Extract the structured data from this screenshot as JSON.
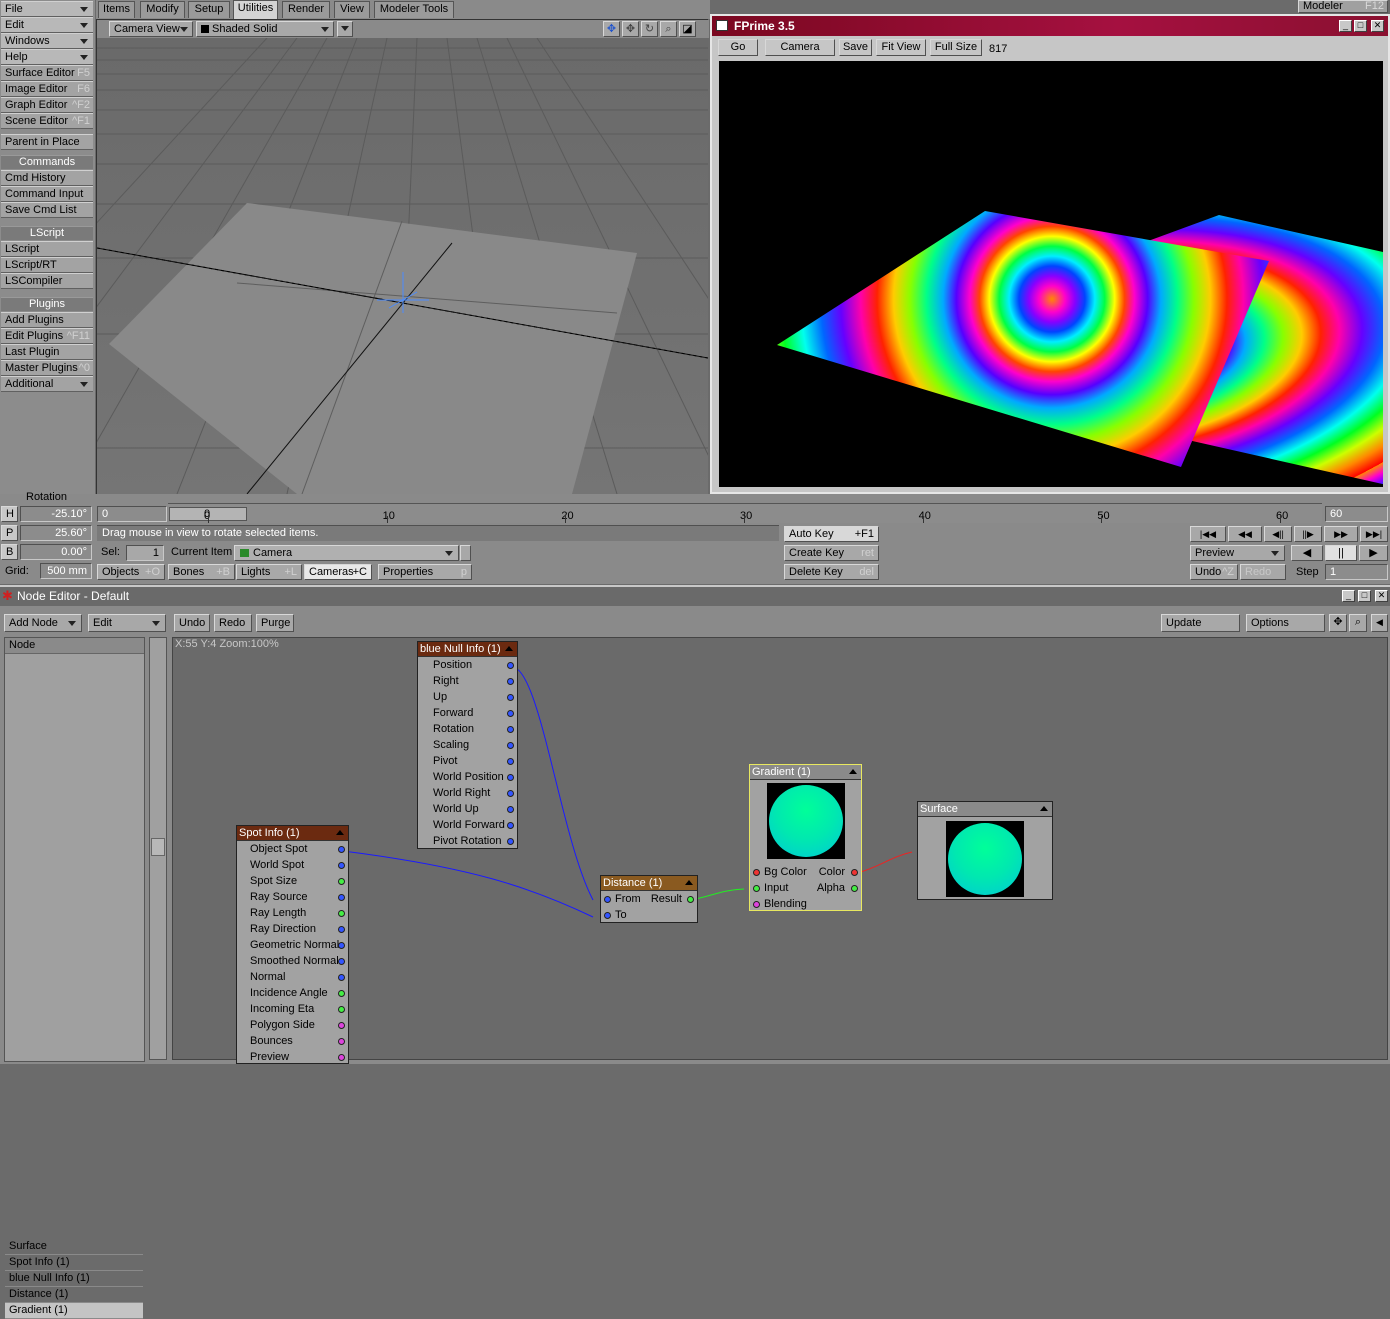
{
  "left_menu": {
    "top": [
      {
        "label": "File",
        "name": "menu-file"
      },
      {
        "label": "Edit",
        "name": "menu-edit"
      },
      {
        "label": "Windows",
        "name": "menu-windows"
      },
      {
        "label": "Help",
        "name": "menu-help"
      }
    ],
    "editors": [
      {
        "label": "Surface Editor",
        "shortcut": "F5"
      },
      {
        "label": "Image Editor",
        "shortcut": "F6"
      },
      {
        "label": "Graph Editor",
        "shortcut": "^F2"
      },
      {
        "label": "Scene Editor",
        "shortcut": "^F1"
      }
    ],
    "parent_in_place": "Parent in Place",
    "commands_header": "Commands",
    "commands": [
      "Cmd History",
      "Command Input",
      "Save Cmd List"
    ],
    "lscript_header": "LScript",
    "lscript": [
      "LScript",
      "LScript/RT",
      "LSCompiler"
    ],
    "plugins_header": "Plugins",
    "plugins": [
      {
        "label": "Add Plugins",
        "shortcut": ""
      },
      {
        "label": "Edit Plugins",
        "shortcut": "^F11"
      },
      {
        "label": "Last Plugin",
        "shortcut": ""
      },
      {
        "label": "Master Plugins",
        "shortcut": "^0"
      }
    ],
    "additional": "Additional"
  },
  "tabs": [
    "Items",
    "Modify",
    "Setup",
    "Utilities",
    "Render",
    "View",
    "Modeler Tools"
  ],
  "active_tab": "Utilities",
  "viewport": {
    "view": "Camera View",
    "shading": "Shaded Solid"
  },
  "fprime": {
    "title": "FPrime 3.5",
    "buttons": [
      "Go",
      "Camera",
      "Save",
      "Fit View",
      "Full Size"
    ],
    "pass_count": "817"
  },
  "modeler_button": {
    "label": "Modeler",
    "shortcut": "F12"
  },
  "rotation": {
    "label": "Rotation",
    "h": {
      "key": "H",
      "value": "-25.10°"
    },
    "p": {
      "key": "P",
      "value": "25.60°"
    },
    "b": {
      "key": "B",
      "value": "0.00°"
    }
  },
  "grid": {
    "label": "Grid:",
    "value": "500 mm"
  },
  "timeline": {
    "start": "0",
    "current": "0",
    "ticks": [
      "0",
      "10",
      "20",
      "30",
      "40",
      "50",
      "60"
    ],
    "end": "60"
  },
  "status_message": "Drag mouse in view to rotate selected items.",
  "sel": {
    "label": "Sel:",
    "value": "1"
  },
  "current_item": {
    "label": "Current Item",
    "value": "Camera"
  },
  "item_types": [
    {
      "label": "Objects",
      "shortcut": "+O"
    },
    {
      "label": "Bones",
      "shortcut": "+B"
    },
    {
      "label": "Lights",
      "shortcut": "+L"
    },
    {
      "label": "Cameras",
      "shortcut": "+C"
    }
  ],
  "properties": {
    "label": "Properties",
    "shortcut": "p"
  },
  "keys": {
    "auto_key": {
      "label": "Auto Key",
      "shortcut": "+F1"
    },
    "create_key": {
      "label": "Create Key",
      "shortcut": "ret"
    },
    "delete_key": {
      "label": "Delete Key",
      "shortcut": "del"
    }
  },
  "playback": {
    "preview": "Preview",
    "undo": "Undo",
    "undo_shortcut": "^Z",
    "redo": "Redo",
    "step_label": "Step",
    "step_value": "1"
  },
  "node_editor": {
    "title": "Node Editor - Default",
    "toolbar": {
      "add_node": "Add Node",
      "edit": "Edit",
      "undo": "Undo",
      "redo": "Redo",
      "purge": "Purge",
      "update": "Update",
      "options": "Options"
    },
    "list_header": "Node",
    "list": [
      "Surface",
      "Spot Info (1)",
      "blue Null Info (1)",
      "Distance (1)",
      "Gradient (1)"
    ],
    "selected": "Gradient (1)",
    "coords": "X:55 Y:4 Zoom:100%",
    "spot_info": {
      "title": "Spot Info (1)",
      "outputs": [
        "Object Spot",
        "World Spot",
        "Spot Size",
        "Ray Source",
        "Ray Length",
        "Ray Direction",
        "Geometric Normal",
        "Smoothed Normal",
        "Normal",
        "Incidence Angle",
        "Incoming Eta",
        "Polygon Side",
        "Bounces",
        "Preview"
      ]
    },
    "null_info": {
      "title": "blue Null Info (1)",
      "outputs": [
        "Position",
        "Right",
        "Up",
        "Forward",
        "Rotation",
        "Scaling",
        "Pivot",
        "World Position",
        "World Right",
        "World Up",
        "World Forward",
        "Pivot Rotation"
      ]
    },
    "distance": {
      "title": "Distance (1)",
      "inputs": [
        "From",
        "To"
      ],
      "output": "Result"
    },
    "gradient": {
      "title": "Gradient (1)",
      "inputs": [
        "Bg Color",
        "Input",
        "Blending"
      ],
      "outputs": [
        "Color",
        "Alpha"
      ]
    },
    "surface": {
      "title": "Surface"
    }
  },
  "colors": {
    "connection_vector": "#1a1aff",
    "connection_scalar": "#22ee22",
    "connection_color": "#ee2222",
    "node_header": "#6b2a10",
    "fprime_title": "#8a0a2a"
  }
}
